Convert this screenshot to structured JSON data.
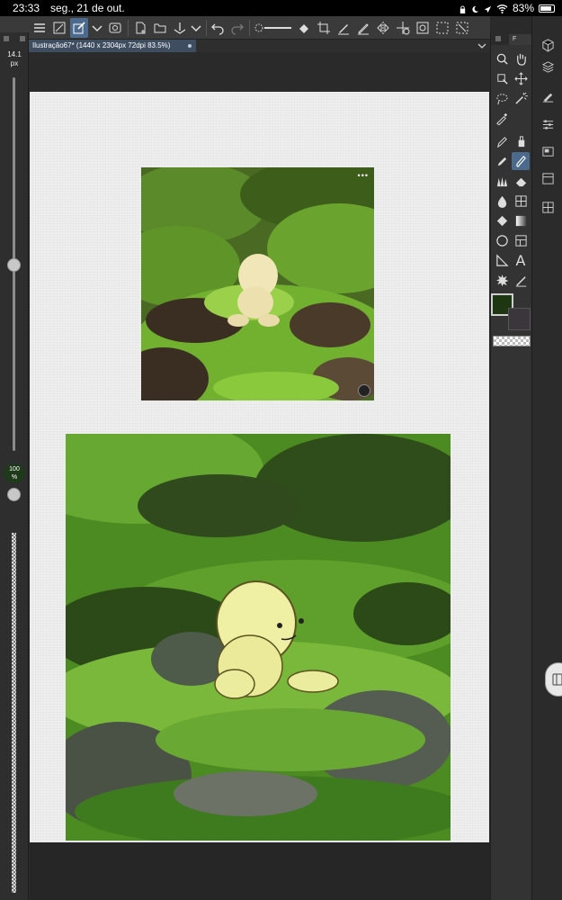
{
  "status": {
    "time": "23:33",
    "date": "seg., 21 de out.",
    "battery": "83%"
  },
  "document": {
    "tab_title": "Ilustração67* (1440 x 2304px 72dpi 83.5%)"
  },
  "left_panel": {
    "brush_size_value": "14.1",
    "brush_size_unit": "px",
    "opacity_value": "100",
    "opacity_unit": "%"
  },
  "tool_panel": {
    "header_label": "F",
    "text_tool_glyph": "A"
  },
  "photo": {
    "menu_glyph": "•••"
  },
  "colors": {
    "accent": "#4b6a8d",
    "main_color": "#1e3611",
    "sub_color": "#3b363c",
    "canvas": "#efefef"
  }
}
